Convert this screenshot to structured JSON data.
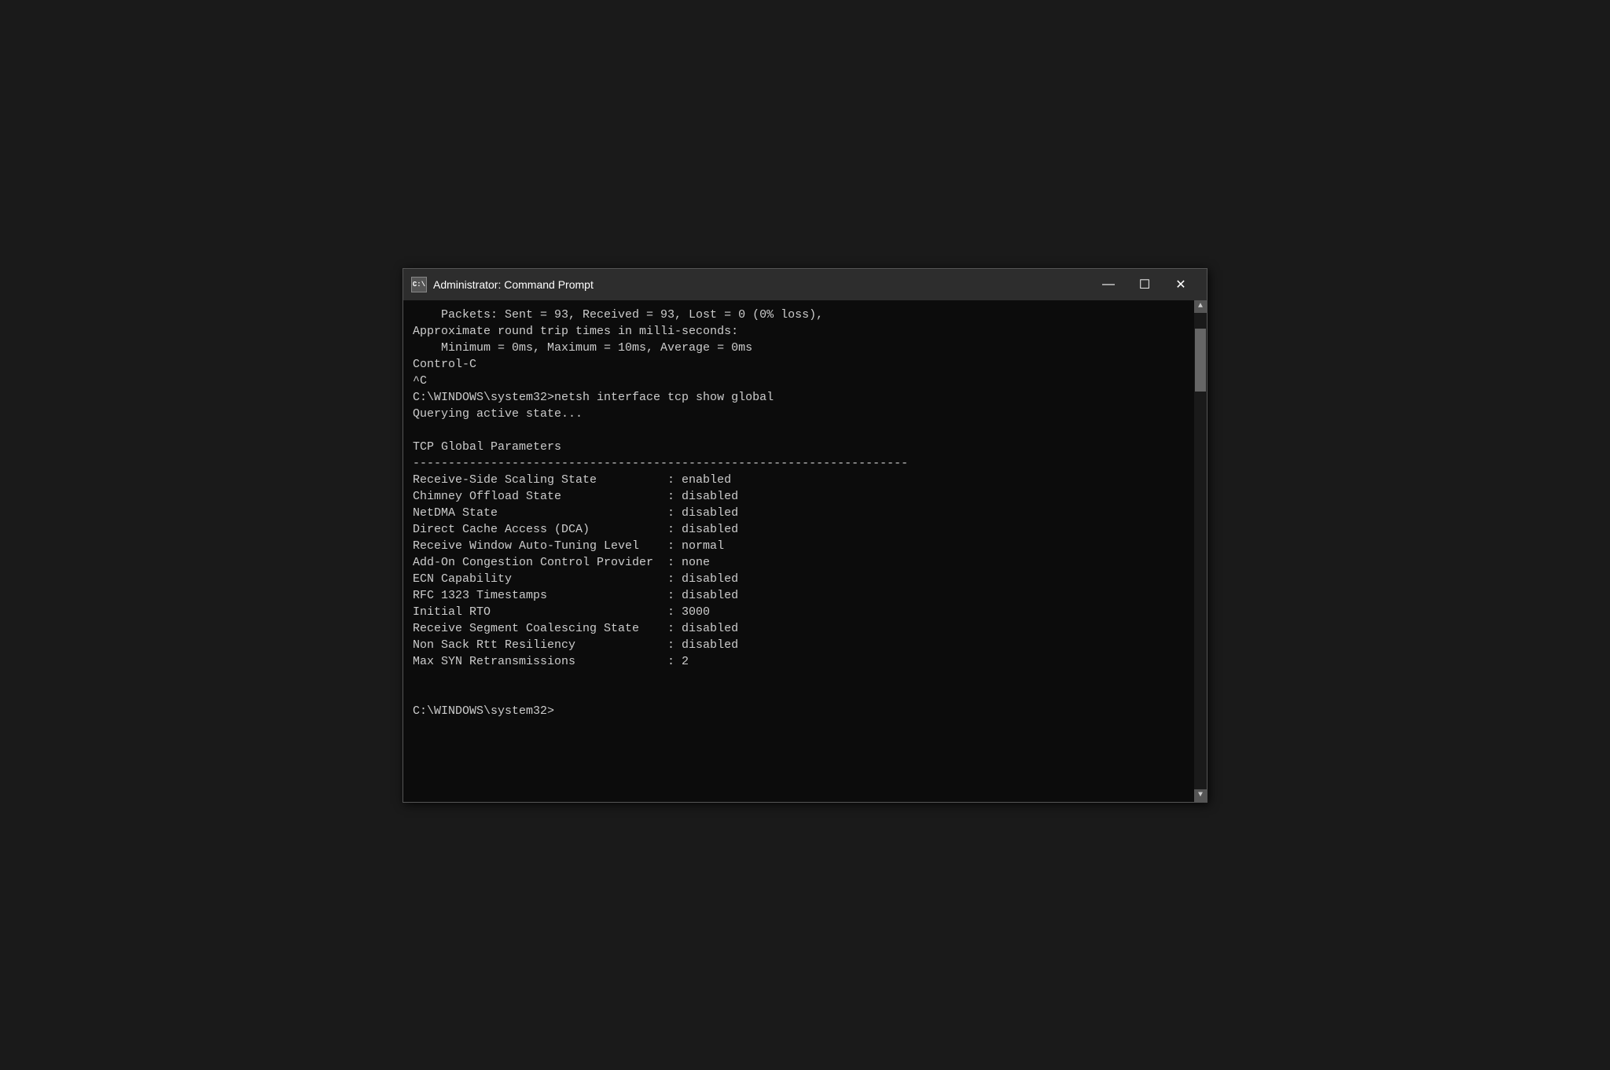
{
  "window": {
    "title": "Administrator: Command Prompt",
    "icon_label": "C:\\",
    "minimize_label": "—",
    "maximize_label": "☐",
    "close_label": "✕"
  },
  "terminal": {
    "lines": [
      "    Packets: Sent = 93, Received = 93, Lost = 0 (0% loss),",
      "Approximate round trip times in milli-seconds:",
      "    Minimum = 0ms, Maximum = 10ms, Average = 0ms",
      "Control-C",
      "^C",
      "C:\\WINDOWS\\system32>netsh interface tcp show global",
      "Querying active state...",
      "",
      "TCP Global Parameters",
      "----------------------------------------------------------------------",
      "Receive-Side Scaling State          : enabled",
      "Chimney Offload State               : disabled",
      "NetDMA State                        : disabled",
      "Direct Cache Access (DCA)           : disabled",
      "Receive Window Auto-Tuning Level    : normal",
      "Add-On Congestion Control Provider  : none",
      "ECN Capability                      : disabled",
      "RFC 1323 Timestamps                 : disabled",
      "Initial RTO                         : 3000",
      "Receive Segment Coalescing State    : disabled",
      "Non Sack Rtt Resiliency             : disabled",
      "Max SYN Retransmissions             : 2",
      "",
      "",
      "C:\\WINDOWS\\system32>"
    ]
  },
  "scrollbar": {
    "up_arrow": "▲",
    "down_arrow": "▼"
  }
}
